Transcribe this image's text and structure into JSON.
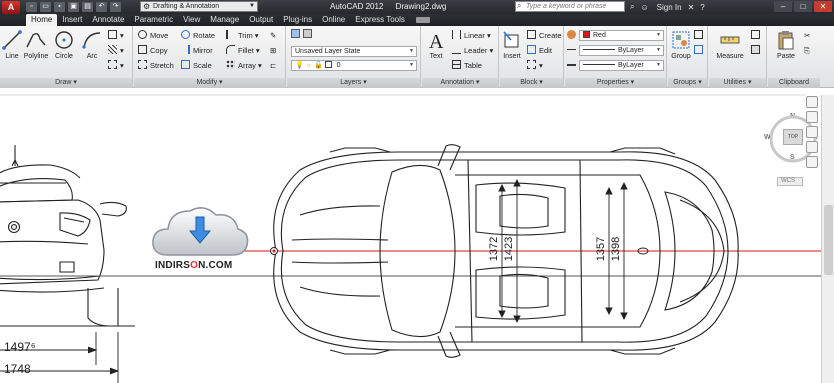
{
  "titlebar": {
    "app_letter": "A",
    "workspace": "Drafting & Annotation",
    "app_name": "AutoCAD 2012",
    "document": "Drawing2.dwg",
    "search_placeholder": "Type a keyword or phrase",
    "sign_in": "Sign In"
  },
  "tabs": [
    "Home",
    "Insert",
    "Annotate",
    "Parametric",
    "View",
    "Manage",
    "Output",
    "Plug-ins",
    "Online",
    "Express Tools"
  ],
  "active_tab": "Home",
  "panels": {
    "draw": {
      "title": "Draw",
      "line": "Line",
      "polyline": "Polyline",
      "circle": "Circle",
      "arc": "Arc"
    },
    "modify": {
      "title": "Modify",
      "move": "Move",
      "rotate": "Rotate",
      "trim": "Trim",
      "copy": "Copy",
      "mirror": "Mirror",
      "fillet": "Fillet",
      "stretch": "Stretch",
      "scale": "Scale",
      "array": "Array"
    },
    "layers": {
      "title": "Layers",
      "layer_state": "Unsaved Layer State",
      "current_layer": "0"
    },
    "annotation": {
      "title": "Annotation",
      "text": "Text",
      "linear": "Linear",
      "leader": "Leader",
      "table": "Table"
    },
    "block": {
      "title": "Block",
      "insert": "Insert",
      "create": "Create",
      "edit": "Edit"
    },
    "properties": {
      "title": "Properties",
      "color": "Red",
      "linetype": "ByLayer",
      "lineweight": "ByLayer"
    },
    "groups": {
      "title": "Groups",
      "group": "Group"
    },
    "utilities": {
      "title": "Utilities",
      "measure": "Measure"
    },
    "clipboard": {
      "title": "Clipboard",
      "paste": "Paste"
    }
  },
  "viewcube": {
    "north": "N",
    "south": "S",
    "east": "E",
    "west": "W",
    "face": "TOP",
    "wcs": "WCS"
  },
  "dimensions": {
    "d1": "1372",
    "d2": "1423",
    "d3": "1357",
    "d4": "1398",
    "d5": "1497⁶",
    "d6": "1748"
  },
  "logo": {
    "text_a": "INDIRS",
    "text_o": "O",
    "text_b": "N.COM"
  },
  "colors": {
    "accent_red": "#d11a1a",
    "ribbon_bg": "#e8e9eb",
    "titlebar_bg": "#2a2c30"
  }
}
